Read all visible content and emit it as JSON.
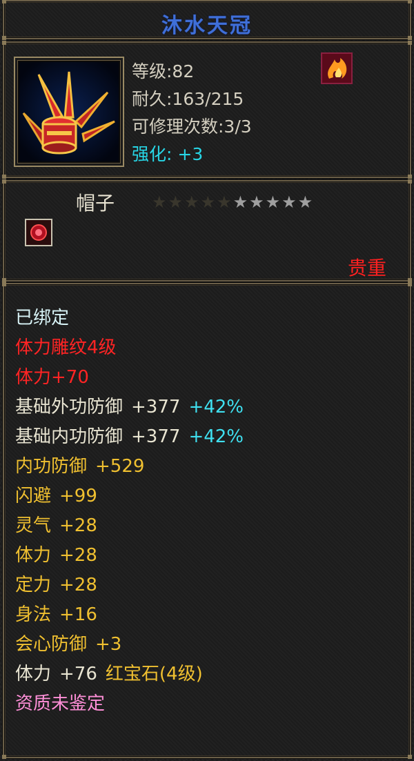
{
  "item": {
    "name": "沐水天冠",
    "level": "等级:82",
    "durability": "耐久:163/215",
    "repairs": "可修理次数:3/3",
    "enhance": "强化: +3",
    "type": "帽子",
    "stars_total": 10,
    "stars_lit": 5,
    "rarity": "贵重"
  },
  "attributes": {
    "bound": "已绑定",
    "engrave": "体力雕纹4级",
    "engrave_bonus": "体力+70",
    "base_outer_def": {
      "label": "基础外功防御",
      "value": "+377",
      "pct": "+42%"
    },
    "base_inner_def": {
      "label": "基础内功防御",
      "value": "+377",
      "pct": "+42%"
    },
    "inner_def": {
      "label": "内功防御",
      "value": "+529"
    },
    "dodge": {
      "label": "闪避",
      "value": "+99"
    },
    "spirit": {
      "label": "灵气",
      "value": "+28"
    },
    "stamina": {
      "label": "体力",
      "value": "+28"
    },
    "focus": {
      "label": "定力",
      "value": "+28"
    },
    "agility": {
      "label": "身法",
      "value": "+16"
    },
    "crit_def": {
      "label": "会心防御",
      "value": "+3"
    },
    "gem": {
      "label": "体力",
      "value": "+76",
      "gem_name": "红宝石(4级)"
    },
    "quality": "资质未鉴定"
  },
  "colors": {
    "title": "#3f6fd8",
    "enhance": "#27d6e6",
    "red": "#ff2424",
    "yellow": "#f0c030",
    "cyan": "#3fe0f0",
    "pink": "#ff8fd8"
  },
  "icons": [
    "hat-item-icon",
    "flame-icon",
    "gem-socket-icon",
    "star-icon"
  ]
}
